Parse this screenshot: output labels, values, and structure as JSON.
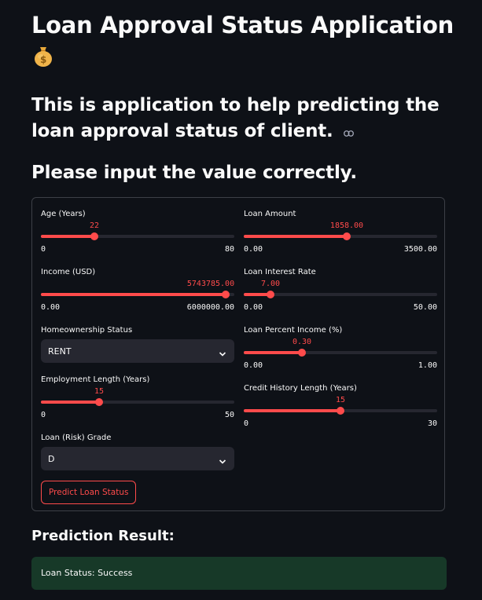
{
  "header": {
    "title": "Loan Approval Status Application",
    "subtitle": "This is application to help predicting the loan approval status of client.",
    "instruction": "Please input the value correctly."
  },
  "form": {
    "age": {
      "label": "Age (Years)",
      "value": "22",
      "min": "0",
      "max": "80",
      "fraction": 0.275
    },
    "loan_amount": {
      "label": "Loan Amount",
      "value": "1858.00",
      "min": "0.00",
      "max": "3500.00",
      "fraction": 0.531
    },
    "income": {
      "label": "Income (USD)",
      "value": "5743785.00",
      "min": "0.00",
      "max": "6000000.00",
      "fraction": 0.957
    },
    "interest_rate": {
      "label": "Loan Interest Rate",
      "value": "7.00",
      "min": "0.00",
      "max": "50.00",
      "fraction": 0.14
    },
    "home_ownership": {
      "label": "Homeownership Status",
      "value": "RENT"
    },
    "percent_income": {
      "label": "Loan Percent Income (%)",
      "value": "0.30",
      "min": "0.00",
      "max": "1.00",
      "fraction": 0.3
    },
    "employment_length": {
      "label": "Employment Length (Years)",
      "value": "15",
      "min": "0",
      "max": "50",
      "fraction": 0.3
    },
    "credit_history": {
      "label": "Credit History Length (Years)",
      "value": "15",
      "min": "0",
      "max": "30",
      "fraction": 0.5
    },
    "loan_grade": {
      "label": "Loan (Risk) Grade",
      "value": "D"
    },
    "predict_button": "Predict Loan Status"
  },
  "result": {
    "heading": "Prediction Result:",
    "status": "Loan Status: Success"
  },
  "colors": {
    "accent": "#ff4b4b",
    "background": "#0e1117",
    "success_bg": "#173928"
  }
}
